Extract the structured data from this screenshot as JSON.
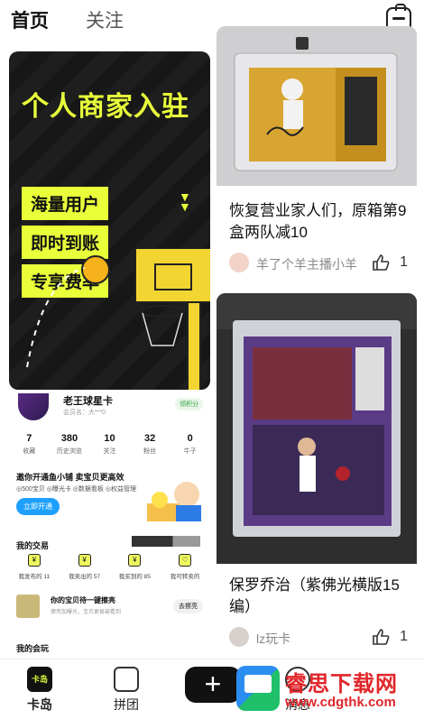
{
  "header": {
    "tabs": [
      {
        "label": "首页",
        "active": true
      },
      {
        "label": "关注",
        "active": false
      }
    ],
    "right_icon": "bag-icon",
    "accent_color": "#d6f43b"
  },
  "banner": {
    "title": "个人商家入驻",
    "pills": [
      "海量用户",
      "即时到账",
      "专享费率"
    ],
    "carousel_total": 4,
    "carousel_active": 2,
    "accent_color": "#e8ff3a"
  },
  "profile": {
    "name": "老王球星卡",
    "subtitle": "会员名：大***0",
    "badge": "领积分",
    "stats": [
      {
        "value": "7",
        "label": "收藏"
      },
      {
        "value": "380",
        "label": "历史浏览"
      },
      {
        "value": "10",
        "label": "关注"
      },
      {
        "value": "32",
        "label": "粉丝"
      },
      {
        "value": "0",
        "label": "牛子"
      }
    ],
    "invite": {
      "title": "邀你开通鱼小铺 卖宝贝更高效",
      "tags": "◎500宝贝 ◎曝光卡 ◎数据看板 ◎权益管理",
      "button": "立即开通"
    },
    "my_trades_title": "我的交易",
    "trades": [
      {
        "icon": "¥",
        "label": "我发布的 11"
      },
      {
        "icon": "¥",
        "label": "我卖出的 57"
      },
      {
        "icon": "¥",
        "label": "我买到的 85"
      },
      {
        "icon": "♡",
        "label": "我可转卖的"
      }
    ],
    "promo": {
      "title": "你的宝贝待一键擦亮",
      "subtitle": "擦亮加曝光，宝贝更易被看到",
      "button": "去擦亮"
    },
    "my_fun_title": "我的会玩"
  },
  "feed": [
    {
      "title": "恢复营业家人们，原箱第9盒两队减10",
      "author": "羊了个羊主播小羊",
      "likes": "1",
      "image_desc": "graded-card-slab-yellow"
    },
    {
      "title": "保罗乔治（紫佛光横版15编）",
      "author": "lz玩卡",
      "likes": "1",
      "image_desc": "paul-george-card-in-toploader"
    }
  ],
  "bottom_nav": [
    {
      "label": "卡岛",
      "icon": "card-island-icon",
      "active": true
    },
    {
      "label": "拼团",
      "icon": "group-buy-icon",
      "active": false
    },
    {
      "label": "",
      "icon": "plus-icon",
      "active": false
    },
    {
      "label": "消息",
      "icon": "message-icon",
      "active": false
    }
  ],
  "nav_home_logo": "卡岛",
  "watermark": {
    "title": "睿思下载网",
    "url": "www.cdgthk.com"
  }
}
